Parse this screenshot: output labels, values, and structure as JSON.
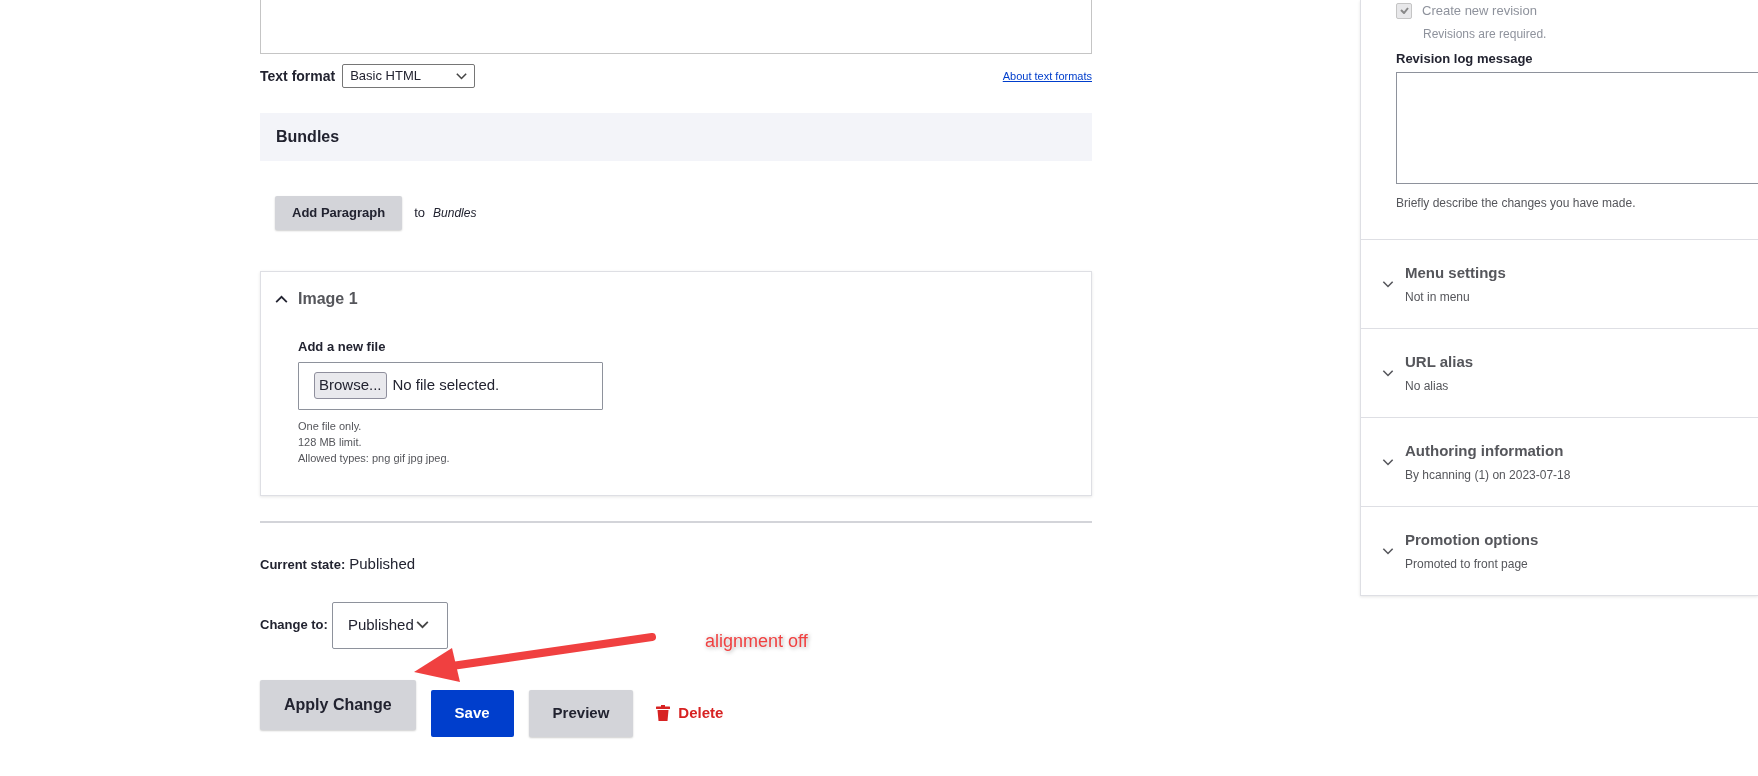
{
  "text_format": {
    "label": "Text format",
    "value": "Basic HTML",
    "help_link": "About text formats"
  },
  "bundles": {
    "title": "Bundles",
    "add_button": "Add Paragraph",
    "add_to_prefix": "to",
    "add_to_target": "Bundles"
  },
  "image_item": {
    "title": "Image 1",
    "expanded": true,
    "field_label": "Add a new file",
    "browse_button": "Browse...",
    "file_status": "No file selected.",
    "help_lines": [
      "One file only.",
      "128 MB limit.",
      "Allowed types: png gif jpg jpeg."
    ]
  },
  "moderation": {
    "current_state_label": "Current state:",
    "current_state": "Published",
    "change_to_label": "Change to:",
    "change_to_value": "Published"
  },
  "actions": [
    {
      "label": "Apply Change",
      "kind": "secondary"
    },
    {
      "label": "Save",
      "kind": "primary"
    },
    {
      "label": "Preview",
      "kind": "secondary"
    },
    {
      "label": "Delete",
      "kind": "danger"
    }
  ],
  "annotation": {
    "text": "alignment off"
  },
  "sidebar": {
    "revision": {
      "checkbox_label": "Create new revision",
      "checked": true,
      "note": "Revisions are required.",
      "log_label": "Revision log message",
      "log_help": "Briefly describe the changes you have made."
    },
    "sections": [
      {
        "title": "Menu settings",
        "summary": "Not in menu",
        "expanded": false
      },
      {
        "title": "URL alias",
        "summary": "No alias",
        "expanded": false
      },
      {
        "title": "Authoring information",
        "summary": "By hcanning (1) on 2023-07-18",
        "expanded": false
      },
      {
        "title": "Promotion options",
        "summary": "Promoted to front page",
        "expanded": false
      }
    ]
  }
}
